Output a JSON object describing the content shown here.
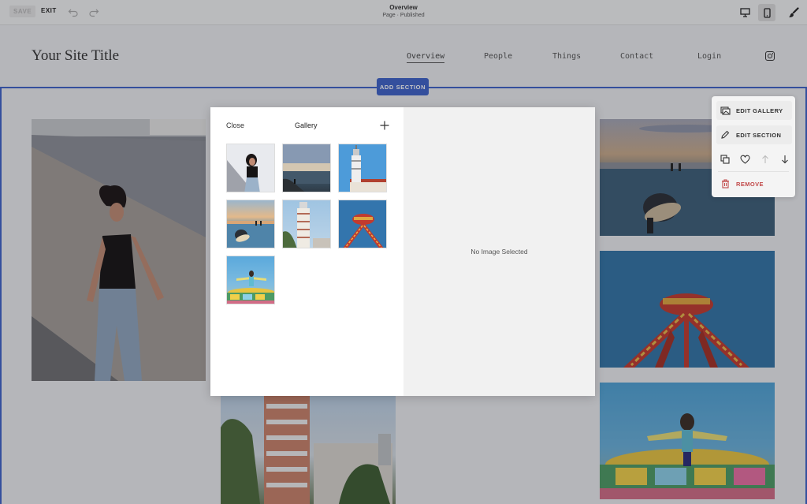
{
  "topbar": {
    "save_label": "SAVE",
    "exit_label": "EXIT",
    "page_title": "Overview",
    "page_status": "Page · Published",
    "undo_icon": "undo-icon",
    "redo_icon": "redo-icon",
    "desktop_icon": "desktop-icon",
    "mobile_icon": "mobile-icon",
    "design_icon": "paintbrush-icon"
  },
  "site": {
    "title": "Your Site Title",
    "nav": [
      {
        "label": "Overview",
        "active": true
      },
      {
        "label": "People",
        "active": false
      },
      {
        "label": "Things",
        "active": false
      },
      {
        "label": "Contact",
        "active": false
      },
      {
        "label": "Login",
        "active": false
      }
    ],
    "social_icon": "instagram-icon"
  },
  "section": {
    "add_section_label": "ADD SECTION"
  },
  "gallery_dialog": {
    "close_label": "Close",
    "title": "Gallery",
    "add_icon": "plus-icon",
    "empty_state": "No Image Selected",
    "thumbnails": [
      {
        "subject": "woman-on-stairs"
      },
      {
        "subject": "seaside-dusk"
      },
      {
        "subject": "lighthouse"
      },
      {
        "subject": "sunset-surfer"
      },
      {
        "subject": "tower-building"
      },
      {
        "subject": "fair-ride"
      },
      {
        "subject": "carousel"
      }
    ]
  },
  "tool_panel": {
    "edit_gallery_label": "EDIT GALLERY",
    "edit_section_label": "EDIT SECTION",
    "remove_label": "REMOVE",
    "actions": [
      "duplicate-icon",
      "heart-icon",
      "arrow-up-icon",
      "arrow-down-icon"
    ]
  },
  "colors": {
    "accent": "#3f63c9",
    "danger": "#c24a4a"
  }
}
